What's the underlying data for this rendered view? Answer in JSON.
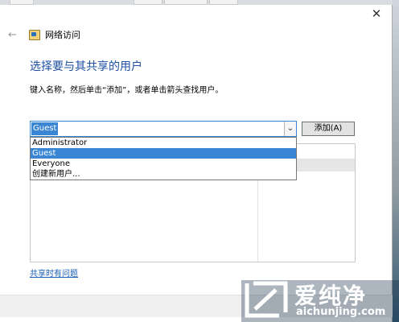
{
  "nav": {
    "title": "网络访问"
  },
  "page": {
    "heading": "选择要与其共享的用户",
    "instruction": "键入名称，然后单击“添加”，或者单击箭头查找用户。"
  },
  "combo": {
    "value": "Guest",
    "arrow": "⌄"
  },
  "add_button": {
    "label": "添加(A)"
  },
  "dropdown": {
    "options": [
      "Administrator",
      "Guest",
      "Everyone",
      "创建新用户..."
    ],
    "selected": "Guest"
  },
  "help_link": "共享时有问题",
  "window": {
    "close_glyph": "✕",
    "back_glyph": "←"
  },
  "watermark": {
    "title": "爱纯净",
    "domain": "aichunjing.com"
  },
  "colors": {
    "accent": "#3a86d4",
    "heading": "#1e4fa3",
    "link": "#1a5fb4"
  }
}
